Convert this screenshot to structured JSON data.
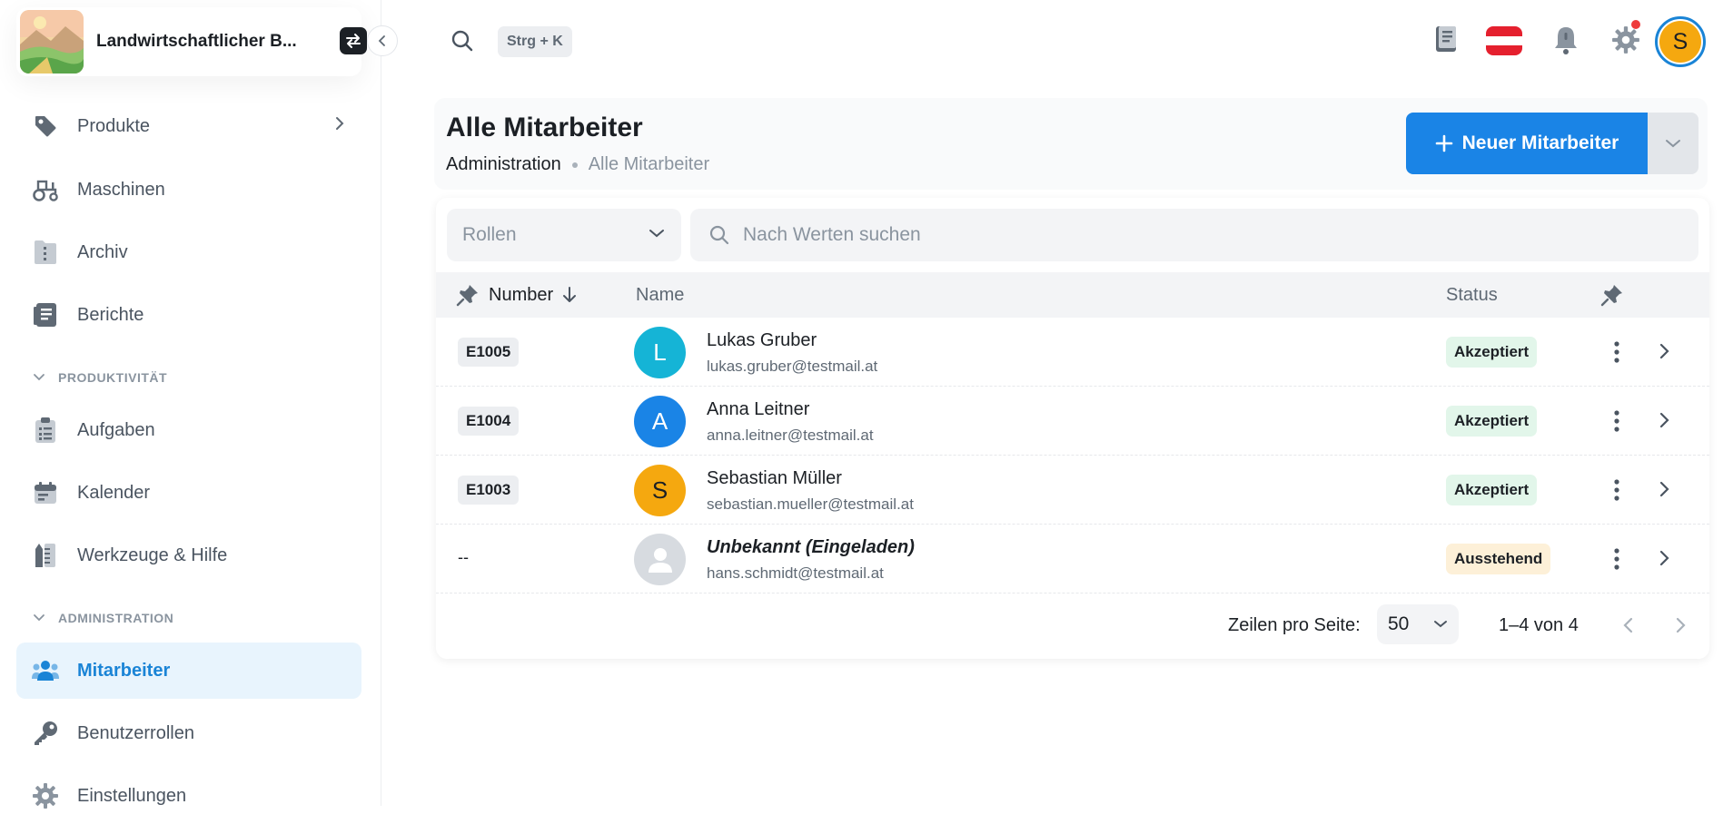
{
  "workspace": {
    "name": "Landwirtschaftlicher B..."
  },
  "sidebar": {
    "items_top": [
      {
        "label": "Produkte",
        "icon": "tag-icon"
      },
      {
        "label": "Maschinen",
        "icon": "tractor-icon"
      },
      {
        "label": "Archiv",
        "icon": "archive-icon"
      },
      {
        "label": "Berichte",
        "icon": "report-icon"
      }
    ],
    "section_productivity": "PRODUKTIVITÄT",
    "items_productivity": [
      {
        "label": "Aufgaben",
        "icon": "clipboard-icon"
      },
      {
        "label": "Kalender",
        "icon": "calendar-icon"
      },
      {
        "label": "Werkzeuge & Hilfe",
        "icon": "tools-icon"
      }
    ],
    "section_admin": "ADMINISTRATION",
    "items_admin": [
      {
        "label": "Mitarbeiter",
        "icon": "users-icon",
        "active": true
      },
      {
        "label": "Benutzerrollen",
        "icon": "key-icon"
      },
      {
        "label": "Einstellungen",
        "icon": "gear-icon"
      }
    ]
  },
  "topbar": {
    "shortcut": "Strg + K",
    "avatar_initial": "S"
  },
  "header": {
    "title": "Alle Mitarbeiter",
    "breadcrumb": [
      "Administration",
      "Alle Mitarbeiter"
    ],
    "new_button": "Neuer Mitarbeiter"
  },
  "filters": {
    "roles_placeholder": "Rollen",
    "search_placeholder": "Nach Werten suchen"
  },
  "table": {
    "columns": {
      "number": "Number",
      "name": "Name",
      "status": "Status"
    },
    "rows": [
      {
        "number": "E1005",
        "initial": "L",
        "avatar_color": "#15b4d6",
        "name": "Lukas Gruber",
        "email": "lukas.gruber@testmail.at",
        "status": "Akzeptiert",
        "status_type": "ok"
      },
      {
        "number": "E1004",
        "initial": "A",
        "avatar_color": "#1a84e6",
        "name": "Anna Leitner",
        "email": "anna.leitner@testmail.at",
        "status": "Akzeptiert",
        "status_type": "ok"
      },
      {
        "number": "E1003",
        "initial": "S",
        "avatar_color": "#f5a80f",
        "name": "Sebastian Müller",
        "email": "sebastian.mueller@testmail.at",
        "status": "Akzeptiert",
        "status_type": "ok"
      },
      {
        "number": "--",
        "initial": "",
        "avatar_color": "#d7dbe0",
        "name": "Unbekannt (Eingeladen)",
        "email": "hans.schmidt@testmail.at",
        "status": "Ausstehend",
        "status_type": "pending"
      }
    ]
  },
  "pagination": {
    "rows_per_page_label": "Zeilen pro Seite:",
    "rows_per_page": "50",
    "range": "1–4 von 4"
  },
  "colors": {
    "accent": "#1a84e6",
    "active_bg": "#e8f4fd",
    "status_ok": "#e2f6ea",
    "status_pending": "#fdf0d8"
  }
}
